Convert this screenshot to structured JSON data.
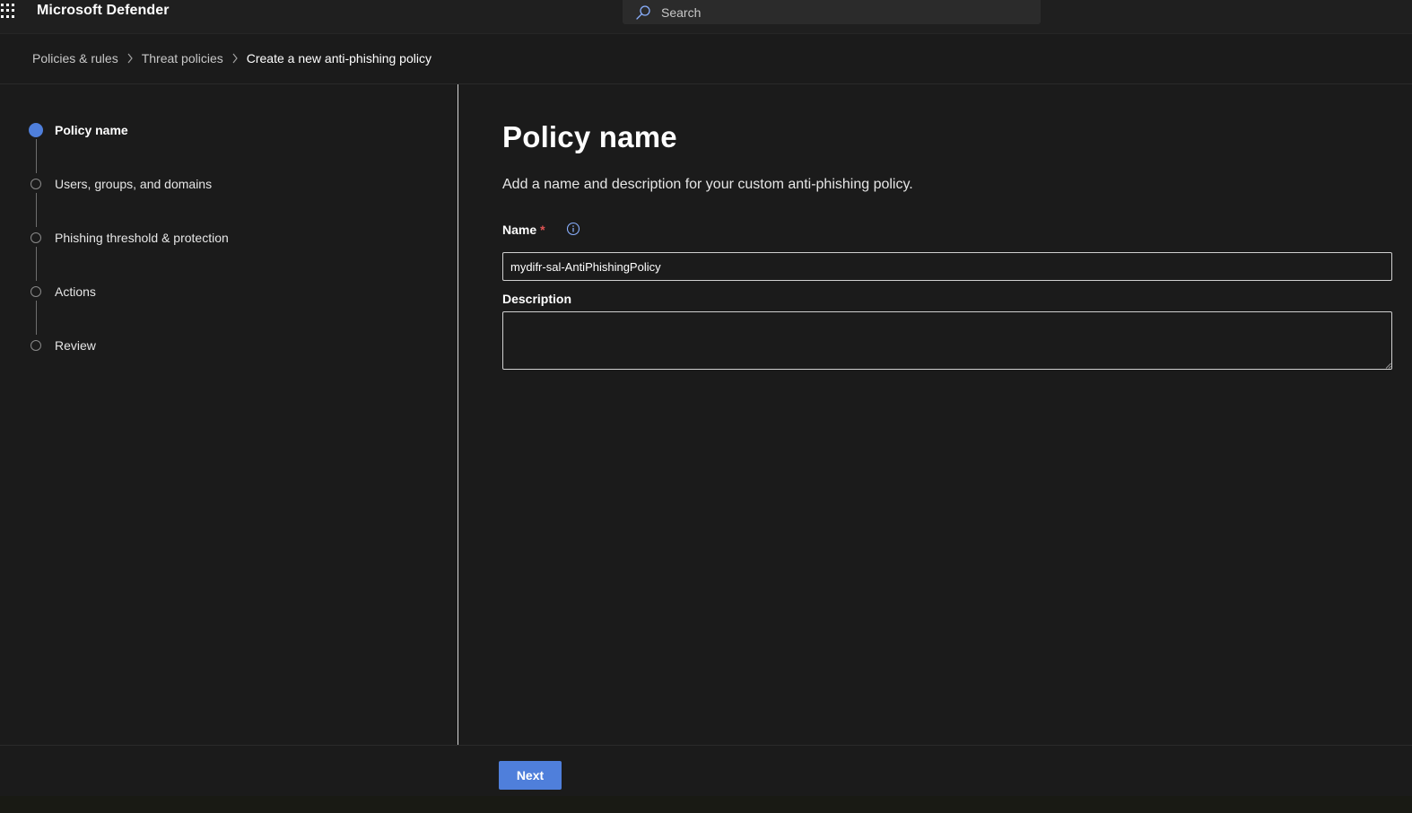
{
  "app": {
    "title": "Microsoft Defender"
  },
  "search": {
    "placeholder": "Search"
  },
  "breadcrumb": [
    "Policies & rules",
    "Threat policies",
    "Create a new anti-phishing policy"
  ],
  "steps": [
    {
      "label": "Policy name",
      "active": true
    },
    {
      "label": "Users, groups, and domains",
      "active": false
    },
    {
      "label": "Phishing threshold & protection",
      "active": false
    },
    {
      "label": "Actions",
      "active": false
    },
    {
      "label": "Review",
      "active": false
    }
  ],
  "main": {
    "title": "Policy name",
    "description": "Add a name and description for your custom anti-phishing policy.",
    "name_label": "Name",
    "required_marker": "*",
    "name_value": "mydifr-sal-AntiPhishingPolicy",
    "description_label": "Description",
    "description_value": ""
  },
  "footer": {
    "next_label": "Next"
  },
  "colors": {
    "accent": "#4f7fdb",
    "required": "#e05454",
    "background": "#1b1b1b"
  },
  "icons": {
    "app_launcher": "waffle-icon",
    "search": "search-icon",
    "info": "info-icon"
  }
}
